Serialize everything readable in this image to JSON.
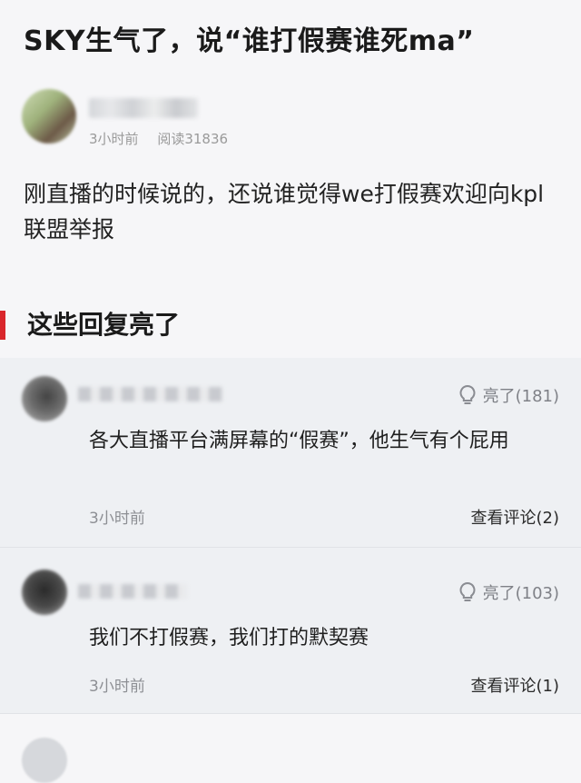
{
  "post": {
    "title": "SKY生气了，说“谁打假赛谁死ma”",
    "time": "3小时前",
    "reads": "阅读31836",
    "body": "刚直播的时候说的，还说谁觉得we打假赛欢迎向kpl联盟举报"
  },
  "section": {
    "title": "这些回复亮了"
  },
  "replies": [
    {
      "likes": "亮了(181)",
      "text": "各大直播平台满屏幕的“假赛”，他生气有个屁用",
      "time": "3小时前",
      "comments": "查看评论(2)"
    },
    {
      "likes": "亮了(103)",
      "text": "我们不打假赛，我们打的默契赛",
      "time": "3小时前",
      "comments": "查看评论(1)"
    }
  ],
  "colors": {
    "accent": "#d9262b",
    "reply_bg": "#eef0f3",
    "page_bg": "#f6f6f8"
  },
  "icons": {
    "like": "lightbulb-icon"
  }
}
